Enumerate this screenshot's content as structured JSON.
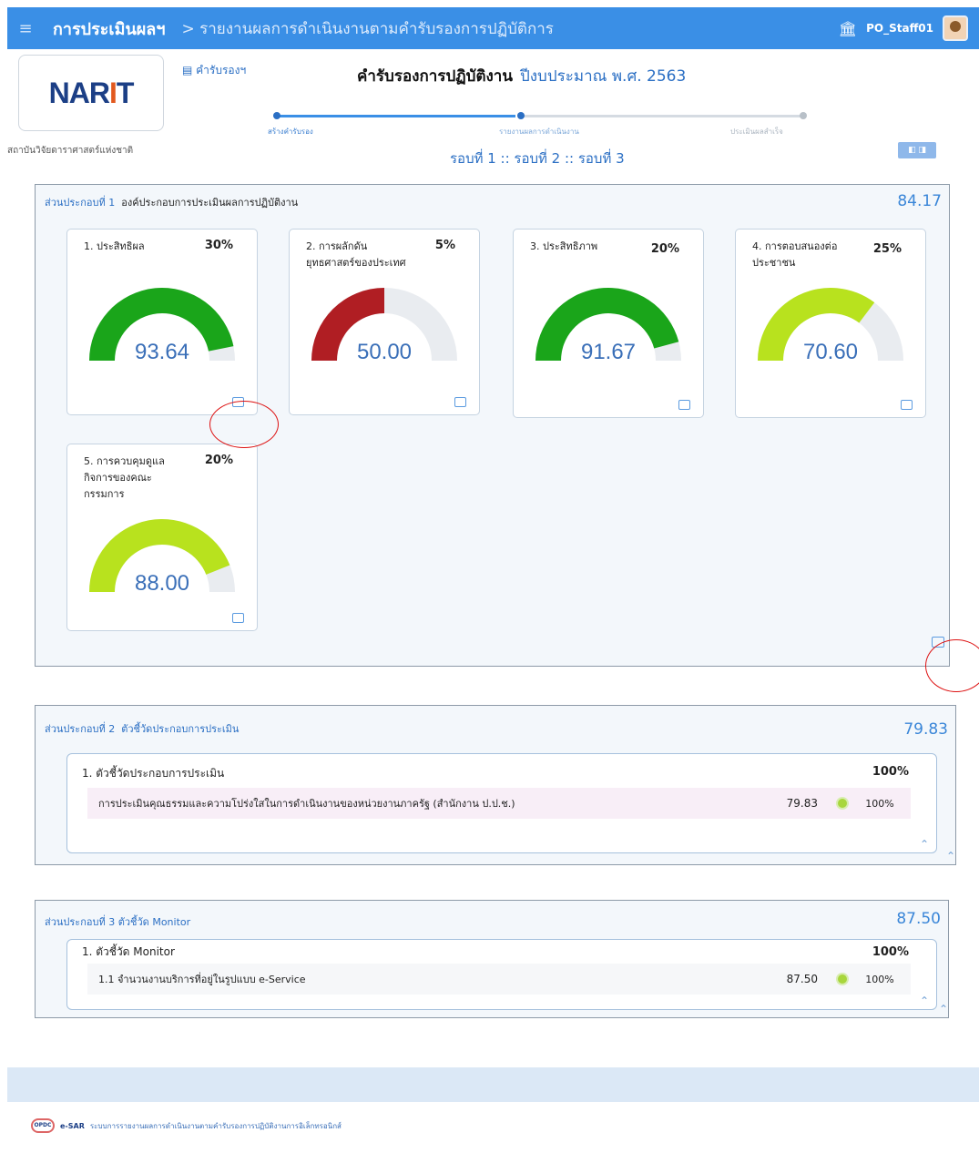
{
  "topbar": {
    "menu_icon": "hamburger-icon",
    "app_name": "การประเมินผลฯ",
    "breadcrumb": "> รายงานผลการดำเนินงานตามคำรับรองการปฏิบัติการ",
    "bank_icon": "bank-icon",
    "user_name": "PO_Staff01"
  },
  "header": {
    "logo_text_main": "NAR",
    "logo_text_accent": "I",
    "logo_text_end": "T",
    "org_name": "สถาบันวิจัยดาราศาสตร์แห่งชาติ",
    "cert_link": "คำรับรองฯ",
    "title": "คำรับรองการปฏิบัติงาน",
    "fiscal_year": "ปีงบประมาณ พ.ศ. 2563",
    "steps": [
      "สร้างคำรับรอง",
      "รายงานผลการดำเนินงาน",
      "ประเมินผลสำเร็จ"
    ],
    "rounds": "รอบที่ 1 :: รอบที่ 2 :: รอบที่ 3",
    "toggle": "◧ ◨"
  },
  "colors": {
    "topbar": "#3a8fe6",
    "green": "#1aa51a",
    "red": "#b01e23",
    "lime": "#b8e21e",
    "track": "#e9ecf0",
    "value": "#3a6fb8"
  },
  "section1": {
    "label": "ส่วนประกอบที่ 1",
    "title": "องค์ประกอบการประเมินผลการปฏิบัติงาน",
    "score": "84.17",
    "cards": [
      {
        "name": "1. ประสิทธิผล",
        "weight": "30%",
        "value": "93.64",
        "fraction": 0.9364,
        "color": "#1aa51a"
      },
      {
        "name": "2. การผลักดันยุทธศาสตร์ของประเทศ",
        "weight": "5%",
        "value": "50.00",
        "fraction": 0.5,
        "color": "#b01e23"
      },
      {
        "name": "3. ประสิทธิภาพ",
        "weight": "20%",
        "value": "91.67",
        "fraction": 0.9167,
        "color": "#1aa51a"
      },
      {
        "name": "4. การตอบสนองต่อประชาชน",
        "weight": "25%",
        "value": "70.60",
        "fraction": 0.706,
        "color": "#b8e21e"
      },
      {
        "name": "5. การควบคุมดูแลกิจการของคณะกรรมการ",
        "weight": "20%",
        "value": "88.00",
        "fraction": 0.88,
        "color": "#b8e21e"
      }
    ]
  },
  "section2": {
    "label": "ส่วนประกอบที่ 2",
    "title": "ตัวชี้วัดประกอบการประเมิน",
    "score": "79.83",
    "group_title": "1. ตัวชี้วัดประกอบการประเมิน",
    "group_weight": "100%",
    "row": {
      "label": "การประเมินคุณธรรมและความโปร่งใสในการดำเนินงานของหน่วยงานภาครัฐ (สำนักงาน ป.ป.ช.)",
      "score": "79.83",
      "pct": "100%"
    }
  },
  "section3": {
    "label": "ส่วนประกอบที่ 3",
    "title": "ตัวชี้วัด Monitor",
    "score": "87.50",
    "group_title": "1. ตัวชี้วัด Monitor",
    "group_weight": "100%",
    "row": {
      "label": "1.1 จำนวนงานบริการที่อยู่ในรูปแบบ e-Service",
      "score": "87.50",
      "pct": "100%"
    }
  },
  "footer": {
    "opdc": "OPDC",
    "esar": "e-SAR",
    "text": "ระบบการรายงานผลการดำเนินงานตามคำรับรองการปฏิบัติงานการอิเล็กทรอนิกส์"
  }
}
